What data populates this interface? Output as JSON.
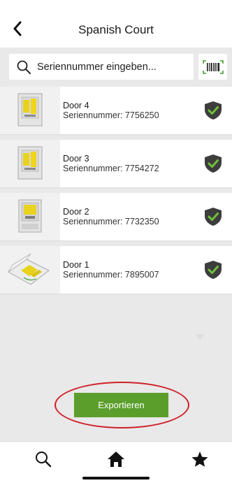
{
  "header": {
    "title": "Spanish Court"
  },
  "search": {
    "placeholder": "Seriennummer eingeben..."
  },
  "doors": [
    {
      "name": "Door 4",
      "serial": "Seriennummer: 7756250",
      "status": "verified"
    },
    {
      "name": "Door 3",
      "serial": "Seriennummer: 7754272",
      "status": "verified"
    },
    {
      "name": "Door 2",
      "serial": "Seriennummer: 7732350",
      "status": "verified"
    },
    {
      "name": "Door 1",
      "serial": "Seriennummer: 7895007",
      "status": "verified"
    }
  ],
  "actions": {
    "export_label": "Exportieren"
  },
  "icons": {
    "back": "chevron-left-icon",
    "search": "search-icon",
    "barcode": "barcode-icon",
    "shield": "shield-check-icon",
    "tab_search": "search-icon",
    "tab_home": "home-icon",
    "tab_favorites": "star-icon"
  },
  "colors": {
    "accent_green": "#5b9e2c",
    "shield_dark": "#3d3d3d",
    "check_green": "#6fbf3a",
    "annotation_red": "#d0222a",
    "barcode_green": "#3f9a2f"
  }
}
